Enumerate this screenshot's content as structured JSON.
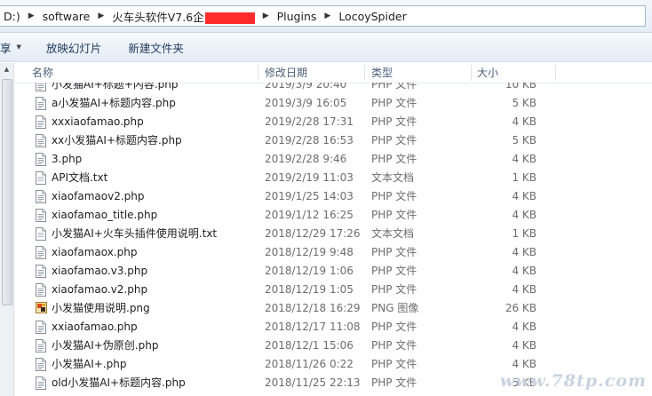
{
  "address": {
    "crumbs": [
      "D:)",
      "software",
      "火车头软件V7.6企",
      "Plugins",
      "LocoySpider"
    ]
  },
  "toolbar": {
    "share_label": "享",
    "slideshow_label": "放映幻灯片",
    "new_folder_label": "新建文件夹"
  },
  "columns": {
    "name": "名称",
    "date": "修改日期",
    "type": "类型",
    "size": "大小"
  },
  "files": [
    {
      "name": "小发猫AI+标题+内容.php",
      "date": "2019/3/9 20:40",
      "type": "PHP 文件",
      "size": "10 KB",
      "icon": "php-file-icon"
    },
    {
      "name": "a小发猫AI+标题内容.php",
      "date": "2019/3/9 16:05",
      "type": "PHP 文件",
      "size": "5 KB",
      "icon": "php-file-icon"
    },
    {
      "name": "xxxiaofamao.php",
      "date": "2019/2/28 17:31",
      "type": "PHP 文件",
      "size": "4 KB",
      "icon": "php-file-icon"
    },
    {
      "name": "xx小发猫AI+标题内容.php",
      "date": "2019/2/28 16:53",
      "type": "PHP 文件",
      "size": "5 KB",
      "icon": "php-file-icon"
    },
    {
      "name": "3.php",
      "date": "2019/2/28 9:46",
      "type": "PHP 文件",
      "size": "4 KB",
      "icon": "php-file-icon"
    },
    {
      "name": "API文档.txt",
      "date": "2019/2/19 11:03",
      "type": "文本文档",
      "size": "1 KB",
      "icon": "txt-file-icon"
    },
    {
      "name": "xiaofamaov2.php",
      "date": "2019/1/25 14:03",
      "type": "PHP 文件",
      "size": "4 KB",
      "icon": "php-file-icon"
    },
    {
      "name": "xiaofamao_title.php",
      "date": "2019/1/12 16:25",
      "type": "PHP 文件",
      "size": "4 KB",
      "icon": "php-file-icon"
    },
    {
      "name": "小发猫AI+火车头插件使用说明.txt",
      "date": "2018/12/29 17:26",
      "type": "文本文档",
      "size": "1 KB",
      "icon": "txt-file-icon"
    },
    {
      "name": "xiaofamaox.php",
      "date": "2018/12/19 9:48",
      "type": "PHP 文件",
      "size": "4 KB",
      "icon": "php-file-icon"
    },
    {
      "name": "xiaofamao.v3.php",
      "date": "2018/12/19 1:06",
      "type": "PHP 文件",
      "size": "4 KB",
      "icon": "php-file-icon"
    },
    {
      "name": "xiaofamao.v2.php",
      "date": "2018/12/19 1:05",
      "type": "PHP 文件",
      "size": "4 KB",
      "icon": "php-file-icon"
    },
    {
      "name": "小发猫使用说明.png",
      "date": "2018/12/18 16:29",
      "type": "PNG 图像",
      "size": "26 KB",
      "icon": "png-image-icon"
    },
    {
      "name": "xxiaofamao.php",
      "date": "2018/12/17 11:08",
      "type": "PHP 文件",
      "size": "4 KB",
      "icon": "php-file-icon"
    },
    {
      "name": "小发猫AI+伪原创.php",
      "date": "2018/12/1 15:06",
      "type": "PHP 文件",
      "size": "4 KB",
      "icon": "php-file-icon"
    },
    {
      "name": "小发猫AI+.php",
      "date": "2018/11/26 0:22",
      "type": "PHP 文件",
      "size": "4 KB",
      "icon": "php-file-icon"
    },
    {
      "name": "old小发猫AI+标题内容.php",
      "date": "2018/11/25 22:13",
      "type": "PHP 文件",
      "size": "5 KB",
      "icon": "php-file-icon"
    }
  ],
  "watermark": "www.78tp.com",
  "colors": {
    "redaction": "#ff2b2b",
    "column_header_text": "#4c607a"
  }
}
